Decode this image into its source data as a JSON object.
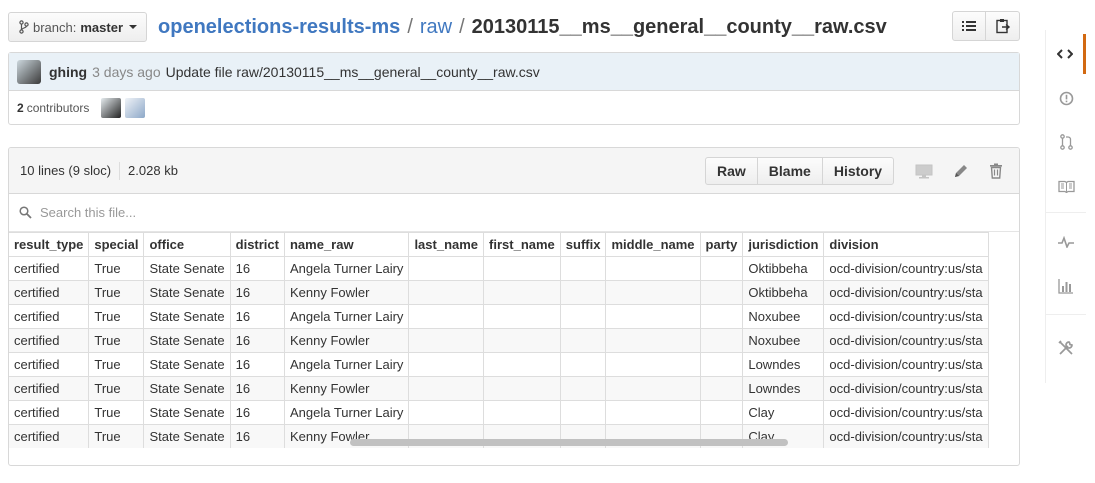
{
  "branch": {
    "label": "branch:",
    "value": "master"
  },
  "breadcrumb": {
    "repo": "openelections-results-ms",
    "sep": "/",
    "dir": "raw",
    "file": "20130115__ms__general__county__raw.csv"
  },
  "commit": {
    "author": "ghing",
    "time": "3 days ago",
    "message": "Update file raw/20130115__ms__general__county__raw.csv"
  },
  "contributors": {
    "count": "2",
    "label": "contributors"
  },
  "file": {
    "lines": "10 lines (9 sloc)",
    "size": "2.028 kb",
    "buttons": {
      "raw": "Raw",
      "blame": "Blame",
      "history": "History"
    }
  },
  "search": {
    "placeholder": "Search this file..."
  },
  "table": {
    "headers": [
      "result_type",
      "special",
      "office",
      "district",
      "name_raw",
      "last_name",
      "first_name",
      "suffix",
      "middle_name",
      "party",
      "jurisdiction",
      "division"
    ],
    "rows": [
      [
        "certified",
        "True",
        "State Senate",
        "16",
        "Angela Turner Lairy",
        "",
        "",
        "",
        "",
        "",
        "Oktibbeha",
        "ocd-division/country:us/sta"
      ],
      [
        "certified",
        "True",
        "State Senate",
        "16",
        "Kenny Fowler",
        "",
        "",
        "",
        "",
        "",
        "Oktibbeha",
        "ocd-division/country:us/sta"
      ],
      [
        "certified",
        "True",
        "State Senate",
        "16",
        "Angela Turner Lairy",
        "",
        "",
        "",
        "",
        "",
        "Noxubee",
        "ocd-division/country:us/sta"
      ],
      [
        "certified",
        "True",
        "State Senate",
        "16",
        "Kenny Fowler",
        "",
        "",
        "",
        "",
        "",
        "Noxubee",
        "ocd-division/country:us/sta"
      ],
      [
        "certified",
        "True",
        "State Senate",
        "16",
        "Angela Turner Lairy",
        "",
        "",
        "",
        "",
        "",
        "Lowndes",
        "ocd-division/country:us/sta"
      ],
      [
        "certified",
        "True",
        "State Senate",
        "16",
        "Kenny Fowler",
        "",
        "",
        "",
        "",
        "",
        "Lowndes",
        "ocd-division/country:us/sta"
      ],
      [
        "certified",
        "True",
        "State Senate",
        "16",
        "Angela Turner Lairy",
        "",
        "",
        "",
        "",
        "",
        "Clay",
        "ocd-division/country:us/sta"
      ],
      [
        "certified",
        "True",
        "State Senate",
        "16",
        "Kenny Fowler",
        "",
        "",
        "",
        "",
        "",
        "Clay",
        "ocd-division/country:us/sta"
      ]
    ]
  },
  "icons": {
    "top": [
      "list-icon",
      "clipboard-icon"
    ],
    "file": [
      "desktop-icon",
      "pencil-icon",
      "trash-icon"
    ],
    "nav": [
      "code-icon",
      "issue-icon",
      "pull-request-icon",
      "book-icon",
      "pulse-icon",
      "graph-icon",
      "tools-icon"
    ]
  },
  "colors": {
    "link": "#4078c0",
    "accent": "#d26911",
    "commit_bg": "#e9f1f7"
  }
}
